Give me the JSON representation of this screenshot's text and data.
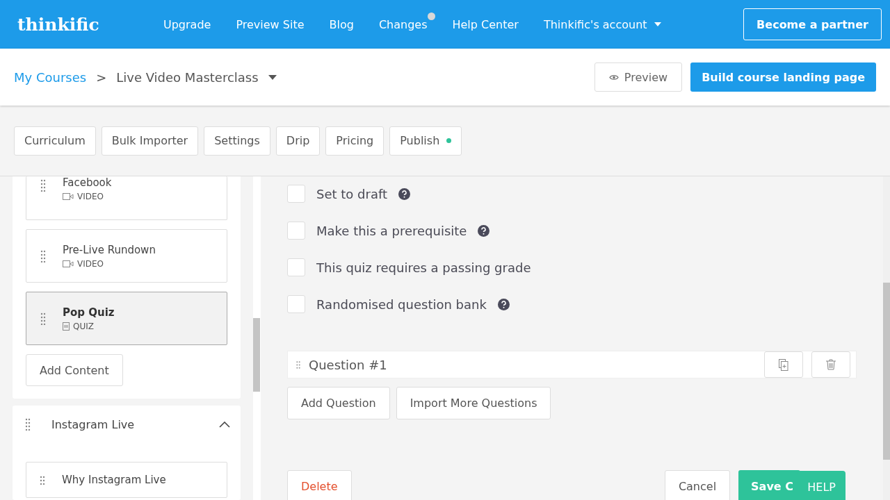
{
  "nav": {
    "logo": "thinkific",
    "links": [
      {
        "label": "Upgrade",
        "badge": false
      },
      {
        "label": "Preview Site",
        "badge": false
      },
      {
        "label": "Blog",
        "badge": false
      },
      {
        "label": "Changes",
        "badge": true
      },
      {
        "label": "Help Center",
        "badge": false
      }
    ],
    "account": "Thinkific's account",
    "partner": "Become a partner"
  },
  "breadcrumb": {
    "root": "My Courses",
    "separator": ">",
    "current": "Live Video Masterclass"
  },
  "actions": {
    "preview": "Preview",
    "build": "Build course landing page"
  },
  "tabs": [
    {
      "label": "Curriculum",
      "indicator": false
    },
    {
      "label": "Bulk Importer",
      "indicator": false
    },
    {
      "label": "Settings",
      "indicator": false
    },
    {
      "label": "Drip",
      "indicator": false
    },
    {
      "label": "Pricing",
      "indicator": false
    },
    {
      "label": "Publish",
      "indicator": true
    }
  ],
  "lessons": [
    {
      "title": "Facebook",
      "type": "VIDEO",
      "kind": "video",
      "selected": false
    },
    {
      "title": "Pre-Live Rundown",
      "type": "VIDEO",
      "kind": "video",
      "selected": false
    },
    {
      "title": "Pop Quiz",
      "type": "QUIZ",
      "kind": "quiz",
      "selected": true
    }
  ],
  "add_content": "Add Content",
  "chapter": {
    "title": "Instagram Live",
    "expanded": true,
    "lessons": [
      {
        "title": "Why Instagram Live"
      }
    ]
  },
  "options": [
    {
      "label": "Set to draft",
      "checked": false,
      "help": true
    },
    {
      "label": "Make this a prerequisite",
      "checked": false,
      "help": true
    },
    {
      "label": "This quiz requires a passing grade",
      "checked": false,
      "help": false
    },
    {
      "label": "Randomised question bank",
      "checked": false,
      "help": true
    }
  ],
  "questions": [
    {
      "title": "Question #1"
    }
  ],
  "question_buttons": [
    "Add Question",
    "Import More Questions"
  ],
  "footer": {
    "delete": "Delete",
    "cancel": "Cancel",
    "save": "Save C"
  },
  "help": "HELP"
}
